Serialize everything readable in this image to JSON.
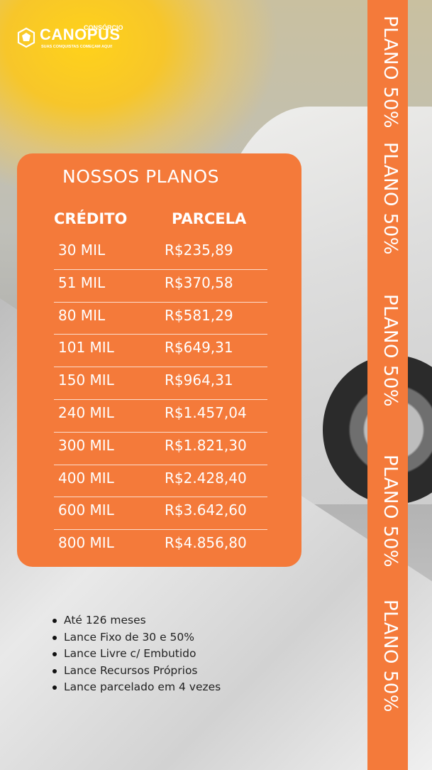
{
  "brand": {
    "name": "CANOPUS",
    "top_label": "CONSÓRCIO",
    "tagline": "SUAS CONQUISTAS COMEÇAM AQUI!",
    "logo_icon": "canopus-star-icon"
  },
  "colors": {
    "accent": "#f47a3a",
    "text_light": "#ffffff",
    "text_dark": "#222222"
  },
  "side_banner": {
    "items": [
      "PLANO 50%",
      "PLANO 50%",
      "PLANO 50%",
      "PLANO 50%",
      "PLANO 50%"
    ]
  },
  "plans": {
    "title": "NOSSOS PLANOS",
    "header_credit": "CRÉDITO",
    "header_installment": "PARCELA",
    "rows": [
      {
        "credit": "30 MIL",
        "installment": "R$235,89"
      },
      {
        "credit": "51 MIL",
        "installment": "R$370,58"
      },
      {
        "credit": "80 MIL",
        "installment": "R$581,29"
      },
      {
        "credit": "101 MIL",
        "installment": "R$649,31"
      },
      {
        "credit": "150 MIL",
        "installment": "R$964,31"
      },
      {
        "credit": "240 MIL",
        "installment": "R$1.457,04"
      },
      {
        "credit": "300 MIL",
        "installment": "R$1.821,30"
      },
      {
        "credit": "400 MIL",
        "installment": "R$2.428,40"
      },
      {
        "credit": "600 MIL",
        "installment": "R$3.642,60"
      },
      {
        "credit": "800 MIL",
        "installment": "R$4.856,80"
      }
    ]
  },
  "features": [
    "Até 126 meses",
    "Lance Fixo de 30 e 50%",
    "Lance Livre c/ Embutido",
    "Lance Recursos Próprios",
    "Lance parcelado em 4 vezes"
  ]
}
